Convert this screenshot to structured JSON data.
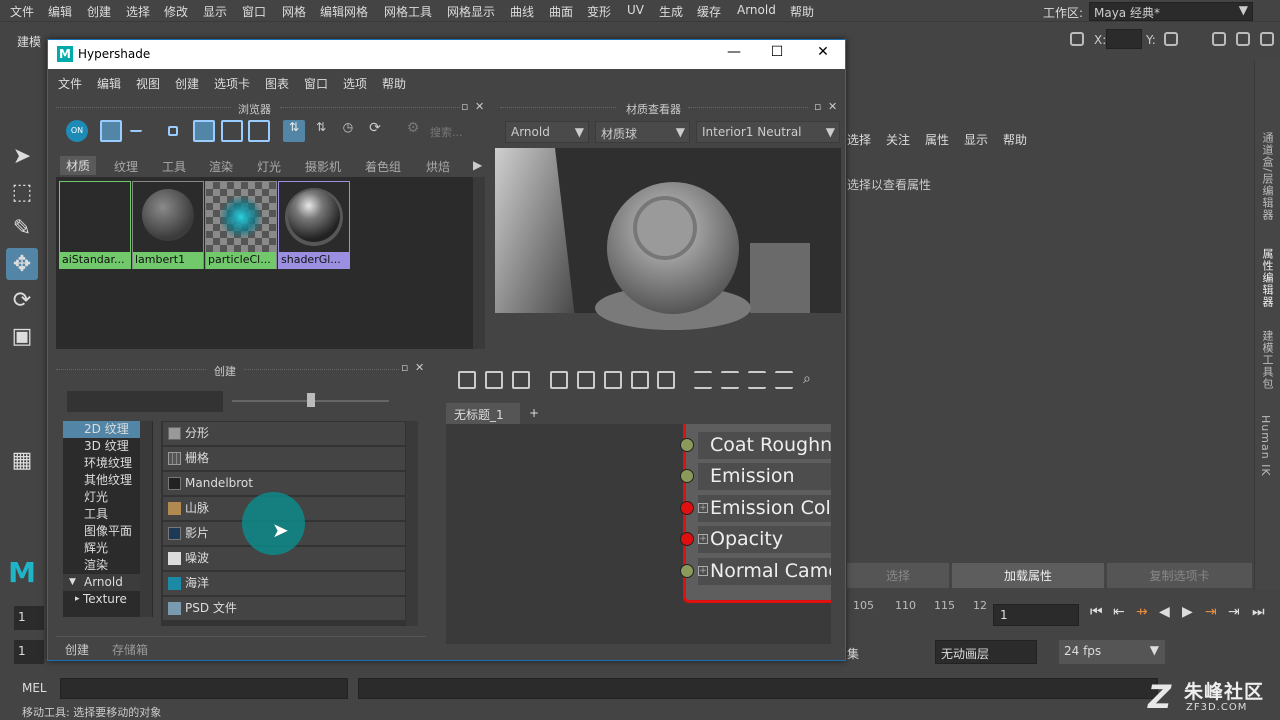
{
  "app": {
    "menubar": [
      "文件",
      "编辑",
      "创建",
      "选择",
      "修改",
      "显示",
      "窗口",
      "网格",
      "编辑网格",
      "网格工具",
      "网格显示",
      "曲线",
      "曲面",
      "变形",
      "UV",
      "生成",
      "缓存",
      "Arnold",
      "帮助"
    ],
    "workspace_label": "工作区:",
    "workspace_value": "Maya 经典*",
    "mode_label": "建模",
    "x_label": "X:",
    "y_label": "Y:"
  },
  "attribute_editor": {
    "menu": [
      "选择",
      "关注",
      "属性",
      "显示",
      "帮助"
    ],
    "hint": "选择以查看属性",
    "buttons": [
      "选择",
      "加载属性",
      "复制选项卡"
    ]
  },
  "right_tabs": [
    "通道盒/层编辑器",
    "属性编辑器",
    "建模工具包",
    "Human IK"
  ],
  "timeline": {
    "ticks": [
      "105",
      "110",
      "115",
      "12"
    ],
    "current_frame": "1",
    "range_start": "1",
    "range_start2": "1",
    "anim_layer": "无动画层",
    "fps": "24 fps",
    "collapsed_label": "集"
  },
  "command_line": {
    "mel_label": "MEL",
    "help_text": "移动工具: 选择要移动的对象"
  },
  "watermark": {
    "text": "朱峰社区",
    "sub": "ZF3D.COM",
    "logo": "Z"
  },
  "hypershade": {
    "title": "Hypershade",
    "menu": [
      "文件",
      "编辑",
      "视图",
      "创建",
      "选项卡",
      "图表",
      "窗口",
      "选项",
      "帮助"
    ],
    "browser": {
      "title": "浏览器",
      "search_placeholder": "搜索...",
      "on_label": "ON",
      "tabs": [
        "材质",
        "纹理",
        "工具",
        "渲染",
        "灯光",
        "摄影机",
        "着色组",
        "烘焙"
      ],
      "swatches": [
        {
          "label": "aiStandar...",
          "color": "#72c96c"
        },
        {
          "label": "lambert1",
          "color": "#72c96c"
        },
        {
          "label": "particleCl...",
          "color": "#72c96c"
        },
        {
          "label": "shaderGl...",
          "color": "#9a8fe0"
        }
      ]
    },
    "material_viewer": {
      "title": "材质查看器",
      "renderer": "Arnold",
      "shape": "材质球",
      "environment": "Interior1 Neutral"
    },
    "create": {
      "title": "创建",
      "categories": [
        {
          "label": "2D 纹理",
          "selected": true
        },
        {
          "label": "3D 纹理"
        },
        {
          "label": "环境纹理"
        },
        {
          "label": "其他纹理"
        },
        {
          "label": "灯光"
        },
        {
          "label": "工具"
        },
        {
          "label": "图像平面"
        },
        {
          "label": "辉光"
        },
        {
          "label": "渲染"
        },
        {
          "label": "Arnold",
          "expanded": true
        },
        {
          "label": "Texture"
        }
      ],
      "nodes": [
        "分形",
        "栅格",
        "Mandelbrot",
        "山脉",
        "影片",
        "噪波",
        "海洋",
        "PSD 文件"
      ]
    },
    "bottom_tabs": [
      "创建",
      "存储箱"
    ],
    "node_editor": {
      "tab_label": "无标题_1",
      "add_tab": "+",
      "attributes": [
        {
          "label": "Coat Roughn",
          "port_color": "#8a9a5b"
        },
        {
          "label": "Emission",
          "port_color": "#8a9a5b"
        },
        {
          "label": "Emission Colo",
          "port_color": "#e01010"
        },
        {
          "label": "Opacity",
          "port_color": "#e01010"
        },
        {
          "label": "Normal Came",
          "port_color": "#8a9a5b"
        }
      ]
    }
  }
}
